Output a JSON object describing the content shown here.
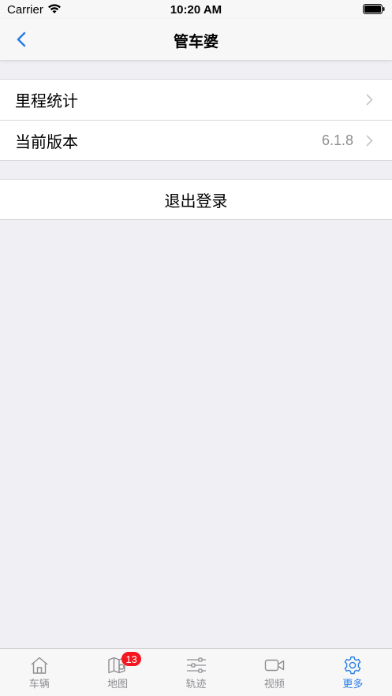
{
  "status_bar": {
    "carrier": "Carrier",
    "time": "10:20 AM"
  },
  "nav": {
    "title": "管车婆",
    "back_icon": "chevron-left-icon"
  },
  "settings": {
    "items": [
      {
        "label": "里程统计",
        "value": ""
      },
      {
        "label": "当前版本",
        "value": "6.1.8"
      }
    ]
  },
  "logout": {
    "label": "退出登录"
  },
  "tabs": [
    {
      "label": "车辆",
      "icon": "house-icon"
    },
    {
      "label": "地图",
      "icon": "map-icon",
      "badge": "13"
    },
    {
      "label": "轨迹",
      "icon": "sliders-icon"
    },
    {
      "label": "视频",
      "icon": "video-camera-icon"
    },
    {
      "label": "更多",
      "icon": "gear-icon",
      "active": true
    }
  ],
  "colors": {
    "accent": "#2a7ee6",
    "badge": "#f5161f",
    "background": "#efeff4"
  }
}
